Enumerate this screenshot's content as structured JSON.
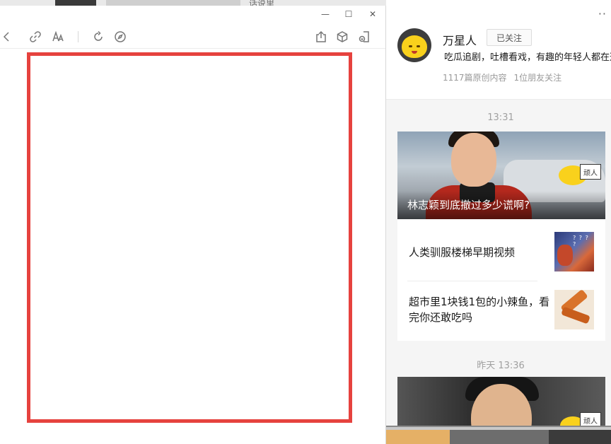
{
  "background": {
    "title_fragment": "话说里"
  },
  "window": {
    "controls": {
      "minimize": "—",
      "maximize": "☐",
      "close": "✕"
    },
    "toolbar_icons": [
      "back-icon",
      "link-icon",
      "font-size-icon",
      "refresh-icon",
      "compass-icon",
      "share-icon",
      "cube-icon",
      "mini-program-icon"
    ]
  },
  "panel": {
    "more": "··",
    "account": {
      "name": "万星人",
      "follow_label": "已关注",
      "description": "吃瓜追剧，吐槽看戏，有趣的年轻人都在这里",
      "original_count": "1117篇原创内容",
      "friends_following": "1位朋友关注"
    },
    "groups": [
      {
        "time": "13:31",
        "hero_title": "林志颖到底撤过多少谎啊?",
        "items": [
          {
            "title": "人类驯服楼梯早期视频"
          },
          {
            "title": "超市里1块钱1包的小辣鱼，看完你还敢吃吗"
          }
        ]
      },
      {
        "time": "昨天 13:36"
      }
    ],
    "badge_text": "顽人"
  },
  "colors": {
    "red_frame": "#e6423e",
    "badge_yellow": "#f9d11c"
  }
}
